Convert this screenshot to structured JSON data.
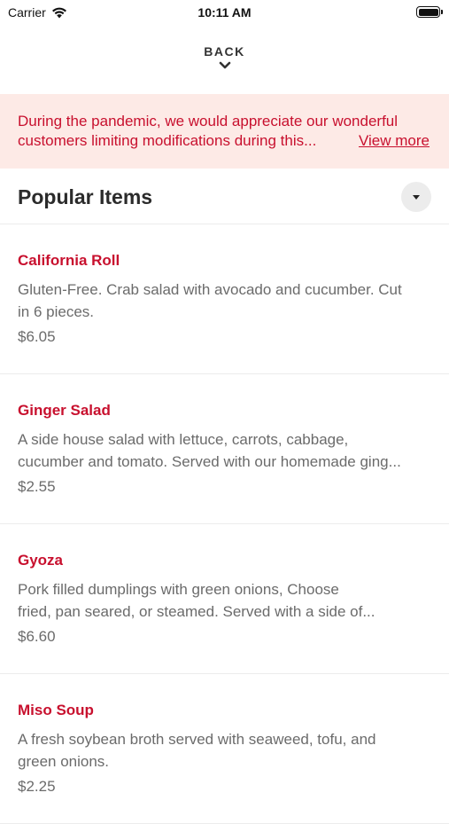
{
  "status_bar": {
    "carrier": "Carrier",
    "time": "10:11 AM",
    "wifi_icon": "wifi-icon",
    "battery_icon": "battery-icon"
  },
  "nav": {
    "back_label": "BACK",
    "chevron_icon": "chevron-down-icon"
  },
  "notice": {
    "line1": "During the pandemic, we would appreciate our wonderful",
    "line2": "customers limiting modifications during this...",
    "link": "View more",
    "background_color": "#fdeae6",
    "text_color": "#c8102e"
  },
  "section": {
    "title": "Popular Items",
    "toggle_icon": "caret-down-icon"
  },
  "items": [
    {
      "name": "California Roll",
      "desc_line1": "Gluten-Free. Crab salad with avocado and cucumber. Cut",
      "desc_line2": "in 6 pieces.",
      "price": "$6.05"
    },
    {
      "name": "Ginger Salad",
      "desc_line1": "A side house salad with lettuce, carrots, cabbage,",
      "desc_line2": "cucumber and tomato. Served with our homemade ging...",
      "price": "$2.55"
    },
    {
      "name": "Gyoza",
      "desc_line1": "Pork filled dumplings with green onions, Choose",
      "desc_line2": "fried, pan seared, or steamed. Served with a side of...",
      "price": "$6.60"
    },
    {
      "name": "Miso Soup",
      "desc_line1": "A fresh soybean broth served with seaweed, tofu, and",
      "desc_line2": "green onions.",
      "price": "$2.25"
    }
  ]
}
